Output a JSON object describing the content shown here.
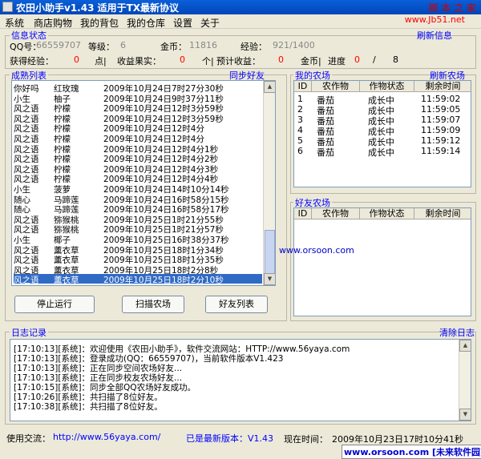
{
  "app": {
    "title": "农田小助手v1.43 适用于TX最新协议",
    "watermark": "脚 本 之 家",
    "site": "www.Jb51.net"
  },
  "menu": [
    "系统",
    "商店购物",
    "我的背包",
    "我的仓库",
    "设置",
    "关于"
  ],
  "info": {
    "group_title": "信息状态",
    "refresh_label": "刷新信息",
    "qq_label": "QQ号：",
    "qq_value": "66559707",
    "level_label": "等级：",
    "level_value": "6",
    "coins_label": "金币：",
    "coins_value": "11816",
    "exp_label": "经验：",
    "exp_value": "921/1400",
    "gain_exp_label": "获得经验：",
    "gain_exp_value": "0",
    "points_unit": "点|",
    "harvest_label": "收益果实：",
    "harvest_value": "0",
    "count_unit": "个|",
    "expected_label": "预计收益：",
    "expected_value": "0",
    "coins2_label": "金币|",
    "progress_label": "进度",
    "progress_value": "0",
    "progress_sep": "/",
    "progress_total": "8"
  },
  "ripe": {
    "group_title": "成熟列表",
    "sync_label": "同步好友",
    "rows": [
      {
        "name": "你好吗",
        "crop": "红玫瑰",
        "time": "2009年10月24日7时27分30秒"
      },
      {
        "name": "小生",
        "crop": "柚子",
        "time": "2009年10月24日9时37分11秒"
      },
      {
        "name": "风之语",
        "crop": "柠檬",
        "time": "2009年10月24日12时3分59秒"
      },
      {
        "name": "风之语",
        "crop": "柠檬",
        "time": "2009年10月24日12时3分59秒"
      },
      {
        "name": "风之语",
        "crop": "柠檬",
        "time": "2009年10月24日12时4分"
      },
      {
        "name": "风之语",
        "crop": "柠檬",
        "time": "2009年10月24日12时4分"
      },
      {
        "name": "风之语",
        "crop": "柠檬",
        "time": "2009年10月24日12时4分1秒"
      },
      {
        "name": "风之语",
        "crop": "柠檬",
        "time": "2009年10月24日12时4分2秒"
      },
      {
        "name": "风之语",
        "crop": "柠檬",
        "time": "2009年10月24日12时4分3秒"
      },
      {
        "name": "风之语",
        "crop": "柠檬",
        "time": "2009年10月24日12时4分4秒"
      },
      {
        "name": "小生",
        "crop": "菠萝",
        "time": "2009年10月24日14时10分14秒"
      },
      {
        "name": "随心",
        "crop": "马蹄莲",
        "time": "2009年10月24日16时58分15秒"
      },
      {
        "name": "随心",
        "crop": "马蹄莲",
        "time": "2009年10月24日16时58分17秒"
      },
      {
        "name": "风之语",
        "crop": "猕猴桃",
        "time": "2009年10月25日1时21分55秒"
      },
      {
        "name": "风之语",
        "crop": "猕猴桃",
        "time": "2009年10月25日1时21分57秒"
      },
      {
        "name": "小生",
        "crop": "椰子",
        "time": "2009年10月25日16时38分37秒"
      },
      {
        "name": "风之语",
        "crop": "薰衣草",
        "time": "2009年10月25日18时1分34秒"
      },
      {
        "name": "风之语",
        "crop": "薰衣草",
        "time": "2009年10月25日18时1分35秒"
      },
      {
        "name": "风之语",
        "crop": "薰衣草",
        "time": "2009年10月25日18时2分8秒"
      },
      {
        "name": "风之语",
        "crop": "薰衣草",
        "time": "2009年10月25日18时2分10秒"
      }
    ],
    "selected_index": 19
  },
  "buttons": {
    "stop": "停止运行",
    "scan": "扫描农场",
    "friends": "好友列表"
  },
  "myfarm": {
    "group_title": "我的农场",
    "refresh_label": "刷新农场",
    "headers": [
      "ID",
      "农作物",
      "作物状态",
      "剩余时间"
    ],
    "rows": [
      {
        "id": "1",
        "crop": "番茄",
        "status": "成长中",
        "time": "11:59:02"
      },
      {
        "id": "2",
        "crop": "番茄",
        "status": "成长中",
        "time": "11:59:05"
      },
      {
        "id": "3",
        "crop": "番茄",
        "status": "成长中",
        "time": "11:59:07"
      },
      {
        "id": "4",
        "crop": "番茄",
        "status": "成长中",
        "time": "11:59:09"
      },
      {
        "id": "5",
        "crop": "番茄",
        "status": "成长中",
        "time": "11:59:12"
      },
      {
        "id": "6",
        "crop": "番茄",
        "status": "成长中",
        "time": "11:59:14"
      }
    ]
  },
  "friendfarm": {
    "group_title": "好友农场",
    "headers": [
      "ID",
      "农作物",
      "作物状态",
      "剩余时间"
    ],
    "watermark": "www.orsoon.com"
  },
  "log": {
    "group_title": "日志记录",
    "clear_label": "清除日志",
    "lines": [
      "[17:10:13][系统]：欢迎使用《农田小助手》，软件交流网站：HTTP://www.56yaya.com",
      "[17:10:13][系统]：登录成功(QQ：66559707)，当前软件版本V1.423",
      "[17:10:13][系统]：正在同步空间农场好友...",
      "[17:10:13][系统]：正在同步校友农场好友...",
      "[17:10:15][系统]：同步全部QQ农场好友成功。",
      "[17:10:26][系统]：共扫描了8位好友。",
      "[17:10:38][系统]：共扫描了8位好友。"
    ]
  },
  "status": {
    "exchange_label": "使用交流：",
    "exchange_url": "http://www.56yaya.com/",
    "version_text": "已是最新版本：V1.43",
    "time_label": "现在时间：",
    "time_value": "2009年10月23日17时10分41秒",
    "footer": "www.orsoon.com [未来软件园]"
  },
  "colors": {
    "accent_blue": "#0000ff",
    "value_red": "#ff0000",
    "selected": "#316ac5"
  }
}
